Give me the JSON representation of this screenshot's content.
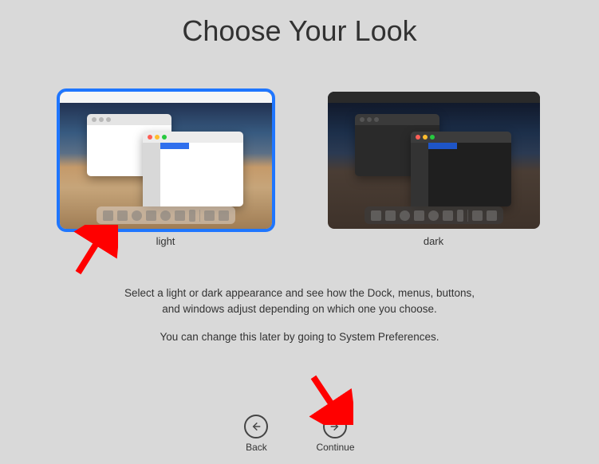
{
  "title": "Choose Your Look",
  "options": {
    "light": {
      "label": "light",
      "selected": true
    },
    "dark": {
      "label": "dark",
      "selected": false
    }
  },
  "description": {
    "line1": "Select a light or dark appearance and see how the Dock, menus, buttons,",
    "line2": "and windows adjust depending on which one you choose.",
    "line3": "You can change this later by going to System Preferences."
  },
  "nav": {
    "back": "Back",
    "continue": "Continue"
  }
}
